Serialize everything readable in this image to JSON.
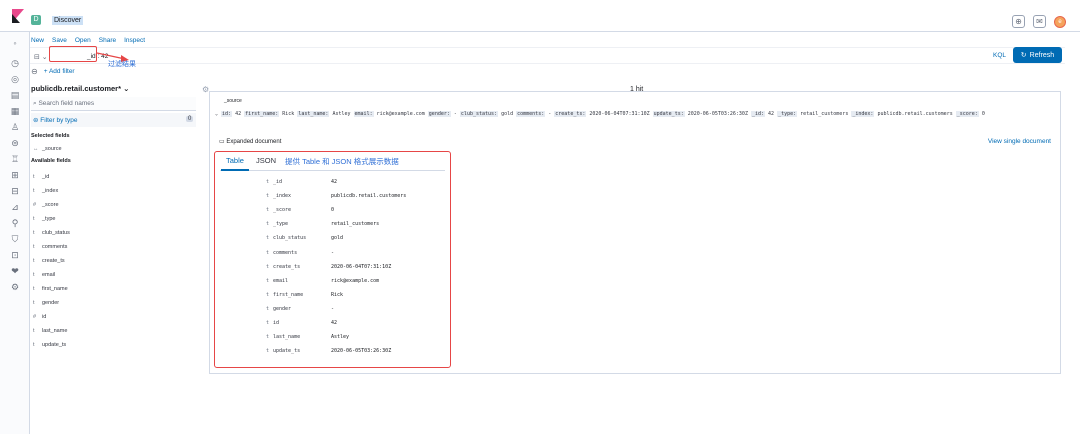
{
  "topbar": {
    "title": "Discover",
    "space_letter": "D",
    "avatar_letter": "e"
  },
  "menu": {
    "items": [
      "New",
      "Save",
      "Open",
      "Share",
      "Inspect"
    ]
  },
  "query": {
    "value": "_id : 42",
    "kql": "KQL",
    "refresh": "Refresh",
    "annotation": "过滤结果"
  },
  "filters": {
    "add": "+ Add filter"
  },
  "sidebar": {
    "index_pattern": "publicdb.retail.customer*",
    "search_placeholder": "Search field names",
    "filter_by_type": "Filter by type",
    "filter_count": "0",
    "selected_title": "Selected fields",
    "selected": [
      {
        "type": "",
        "name": "_source"
      }
    ],
    "available_title": "Available fields",
    "available": [
      {
        "type": "t",
        "name": "_id"
      },
      {
        "type": "t",
        "name": "_index"
      },
      {
        "type": "#",
        "name": "_score"
      },
      {
        "type": "t",
        "name": "_type"
      },
      {
        "type": "t",
        "name": "club_status"
      },
      {
        "type": "t",
        "name": "comments"
      },
      {
        "type": "t",
        "name": "create_ts"
      },
      {
        "type": "t",
        "name": "email"
      },
      {
        "type": "t",
        "name": "first_name"
      },
      {
        "type": "t",
        "name": "gender"
      },
      {
        "type": "#",
        "name": "id"
      },
      {
        "type": "t",
        "name": "last_name"
      },
      {
        "type": "t",
        "name": "update_ts"
      }
    ]
  },
  "main": {
    "hits": "1 hit",
    "source_header": "_source",
    "source_row": [
      [
        "id:",
        "42"
      ],
      [
        "first_name:",
        "Rick"
      ],
      [
        "last_name:",
        "Astley"
      ],
      [
        "email:",
        "rick@example.com"
      ],
      [
        "gender:",
        "-"
      ],
      [
        "club_status:",
        "gold"
      ],
      [
        "comments:",
        "-"
      ],
      [
        "create_ts:",
        "2020-06-04T07:31:10Z"
      ],
      [
        "update_ts:",
        "2020-06-05T03:26:30Z"
      ],
      [
        "_id:",
        "42"
      ],
      [
        "_type:",
        "retail_customers"
      ],
      [
        "_index:",
        "publicdb.retail.customers"
      ],
      [
        "_score:",
        "0"
      ]
    ],
    "expanded_title": "Expanded document",
    "view_single": "View single document",
    "tabs": [
      "Table",
      "JSON"
    ],
    "tabs_annotation": "提供 Table 和 JSON 格式展示数据",
    "doc_rows": [
      {
        "type": "t",
        "field": "_id",
        "value": "42"
      },
      {
        "type": "t",
        "field": "_index",
        "value": "publicdb.retail.customers"
      },
      {
        "type": "t",
        "field": "_score",
        "value": "0"
      },
      {
        "type": "t",
        "field": "_type",
        "value": "retail_customers"
      },
      {
        "type": "t",
        "field": "club_status",
        "value": "gold"
      },
      {
        "type": "t",
        "field": "comments",
        "value": "-"
      },
      {
        "type": "t",
        "field": "create_ts",
        "value": "2020-06-04T07:31:10Z"
      },
      {
        "type": "t",
        "field": "email",
        "value": "rick@example.com"
      },
      {
        "type": "t",
        "field": "first_name",
        "value": "Rick"
      },
      {
        "type": "t",
        "field": "gender",
        "value": "-"
      },
      {
        "type": "t",
        "field": "id",
        "value": "42"
      },
      {
        "type": "t",
        "field": "last_name",
        "value": "Astley"
      },
      {
        "type": "t",
        "field": "update_ts",
        "value": "2020-06-05T03:26:30Z"
      }
    ]
  },
  "colors": {
    "accent": "#006bb4",
    "annotation_red": "#e64646",
    "annotation_blue": "#2f6fd6"
  }
}
